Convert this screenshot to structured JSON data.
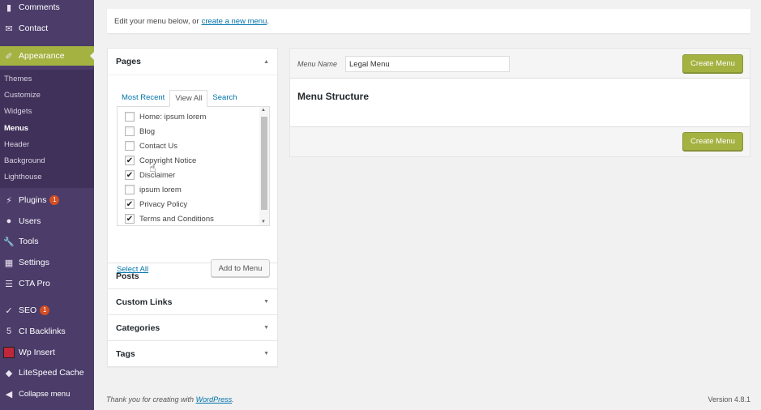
{
  "sidebar": {
    "items": [
      {
        "label": "Comments",
        "icon": "comment-icon"
      },
      {
        "label": "Contact",
        "icon": "envelope-icon"
      },
      {
        "label": "Appearance",
        "icon": "paintbrush-icon",
        "active": true
      },
      {
        "label": "Plugins",
        "icon": "plugin-icon",
        "badge": "1"
      },
      {
        "label": "Users",
        "icon": "user-icon"
      },
      {
        "label": "Tools",
        "icon": "wrench-icon"
      },
      {
        "label": "Settings",
        "icon": "settings-icon"
      },
      {
        "label": "CTA Pro",
        "icon": "cta-icon"
      },
      {
        "label": "SEO",
        "icon": "yoast-icon",
        "badge": "1"
      },
      {
        "label": "CI Backlinks",
        "icon": "backlinks-icon"
      },
      {
        "label": "Wp Insert",
        "icon": "wp-insert-icon"
      },
      {
        "label": "LiteSpeed Cache",
        "icon": "litespeed-icon"
      },
      {
        "label": "Collapse menu",
        "icon": "collapse-icon"
      }
    ],
    "submenu": [
      "Themes",
      "Customize",
      "Widgets",
      "Menus",
      "Header",
      "Background",
      "Lighthouse"
    ],
    "current_submenu": "Menus"
  },
  "notice": {
    "text": "Edit your menu below, or",
    "link": "create a new menu",
    "suffix": "."
  },
  "accordion": {
    "pages_title": "Pages",
    "tabs": [
      "Most Recent",
      "View All",
      "Search"
    ],
    "active_tab": "View All",
    "pages": [
      {
        "label": "Home: ipsum lorem",
        "checked": false
      },
      {
        "label": "Blog",
        "checked": false
      },
      {
        "label": "Contact Us",
        "checked": false
      },
      {
        "label": "Copyright Notice",
        "checked": true
      },
      {
        "label": "Disclaimer",
        "checked": true
      },
      {
        "label": "ipsum lorem",
        "checked": false
      },
      {
        "label": "Privacy Policy",
        "checked": true
      },
      {
        "label": "Terms and Conditions",
        "checked": true
      }
    ],
    "select_all": "Select All",
    "add_to_menu": "Add to Menu",
    "sections": [
      "Posts",
      "Custom Links",
      "Categories",
      "Tags"
    ]
  },
  "menu_panel": {
    "name_label": "Menu Name",
    "name_value": "Legal Menu",
    "create_button": "Create Menu",
    "structure_title": "Menu Structure"
  },
  "footer": {
    "thanks": "Thank you for creating with",
    "link": "WordPress",
    "suffix": ".",
    "version": "Version 4.8.1"
  },
  "colors": {
    "sidebar_bg": "#4b3c6a",
    "accent": "#a3b240",
    "link": "#0073aa",
    "badge": "#d54e21"
  }
}
